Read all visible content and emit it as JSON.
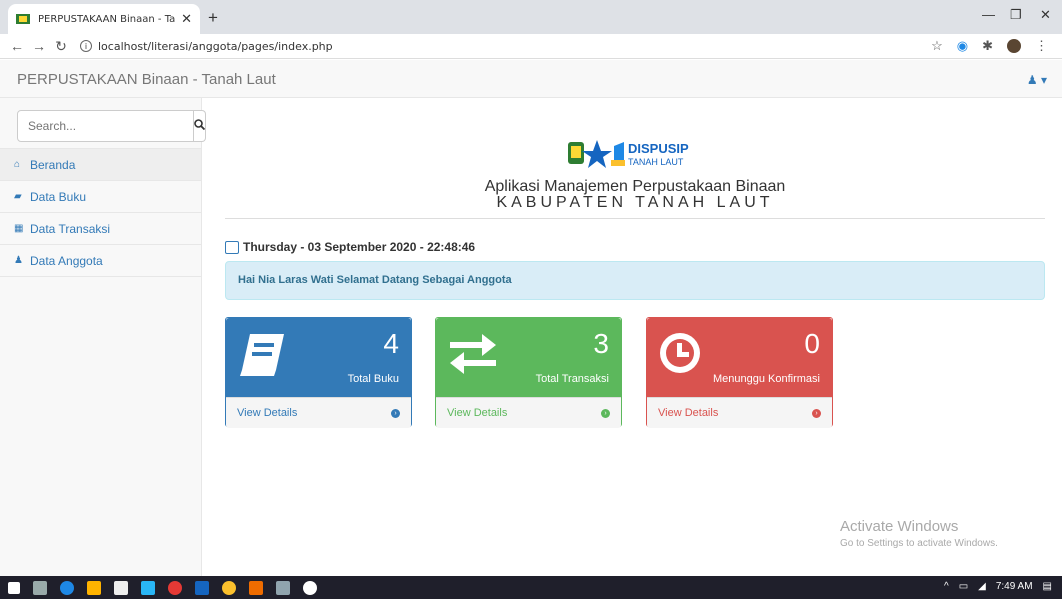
{
  "browser": {
    "tab_title": "PERPUSTAKAAN Binaan - Tanah",
    "url": "localhost/literasi/anggota/pages/index.php"
  },
  "navbar": {
    "brand": "PERPUSTAKAAN Binaan - Tanah Laut"
  },
  "sidebar": {
    "search_placeholder": "Search...",
    "items": [
      {
        "label": "Beranda",
        "icon": "home-icon"
      },
      {
        "label": "Data Buku",
        "icon": "book-icon"
      },
      {
        "label": "Data Transaksi",
        "icon": "grid-icon"
      },
      {
        "label": "Data Anggota",
        "icon": "user-icon"
      }
    ]
  },
  "main": {
    "logo_text_1": "DISPUSIP",
    "logo_text_2": "TANAH LAUT",
    "title": "Aplikasi Manajemen Perpustakaan Binaan",
    "subtitle": "KABUPATEN TANAH LAUT",
    "datetime": "Thursday - 03 September 2020 - 22:48:46",
    "welcome": "Hai Nia Laras Wati Selamat Datang Sebagai Anggota",
    "panels": [
      {
        "count": "4",
        "label": "Total Buku",
        "link": "View Details",
        "color": "#337ab7",
        "icon": "book-icon"
      },
      {
        "count": "3",
        "label": "Total Transaksi",
        "link": "View Details",
        "color": "#5cb85c",
        "icon": "exchange-icon"
      },
      {
        "count": "0",
        "label": "Menunggu Konfirmasi",
        "link": "View Details",
        "color": "#d9534f",
        "icon": "clock-icon"
      }
    ]
  },
  "watermark": {
    "line1": "Activate Windows",
    "line2": "Go to Settings to activate Windows."
  },
  "taskbar": {
    "time": "7:49 AM"
  }
}
